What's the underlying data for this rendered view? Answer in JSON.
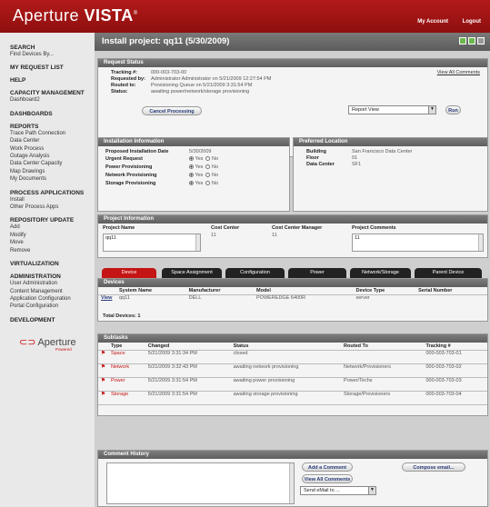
{
  "app": {
    "brand_light": "Aperture ",
    "brand_bold": "VISTA",
    "brand_reg": "®"
  },
  "toplinks": {
    "account": "My Account",
    "logout": "Logout"
  },
  "sidebar": {
    "sections": [
      {
        "head": "SEARCH",
        "items": [
          "Find Devices By..."
        ]
      },
      {
        "head": "MY REQUEST LIST",
        "items": []
      },
      {
        "head": "HELP",
        "items": []
      },
      {
        "head": "CAPACITY MANAGEMENT",
        "items": [
          "Dashboard2"
        ]
      },
      {
        "head": "DASHBOARDS",
        "items": []
      },
      {
        "head": "REPORTS",
        "items": [
          "Trace Path Connection",
          "Data Center",
          "Work Process",
          "Outage Analysis",
          "Data Center Capacity",
          "Map Drawings",
          "My Documents"
        ]
      },
      {
        "head": "PROCESS APPLICATIONS",
        "items": [
          "Install",
          "Other Process Apps"
        ]
      },
      {
        "head": "REPOSITORY UPDATE",
        "items": [
          "Add",
          "Modify",
          "Move",
          "Remove"
        ]
      },
      {
        "head": "VIRTUALIZATION",
        "items": []
      },
      {
        "head": "ADMINISTRATION",
        "items": [
          "User Administration",
          "Content Management",
          "Application Configuration",
          "Portal Configuration"
        ]
      },
      {
        "head": "DEVELOPMENT",
        "items": []
      }
    ],
    "logo": "Aperture",
    "logo_sub": "Powered"
  },
  "page": {
    "title": "Install project: qq11 (5/30/2009)"
  },
  "request_status": {
    "header": "Request Status",
    "tracking_label": "Tracking #:",
    "tracking_value": "000-003-703-00",
    "requested_label": "Requested by:",
    "requested_value": "Administrator Administrator on 5/21/2009 12:27:54 PM",
    "routed_label": "Routed to:",
    "routed_value": "Provisioning Queue on 5/21/2009 3:31:54 PM",
    "status_label": "Status:",
    "status_value": "awaiting power/network/storage provisioning",
    "view_all_comments": "View All Comments",
    "cancel_button": "Cancel Processing",
    "report_view": "Report View",
    "run_button": "Run"
  },
  "installation_info": {
    "header": "Installation Information",
    "date_label": "Proposed Installation Date",
    "date_value": "5/30/2009",
    "rows": [
      {
        "label": "Urgent Request",
        "yes": "Yes",
        "no": "No"
      },
      {
        "label": "Power Provisioning",
        "yes": "Yes",
        "no": "No"
      },
      {
        "label": "Network Provisioning",
        "yes": "Yes",
        "no": "No"
      },
      {
        "label": "Storage Provisioning",
        "yes": "Yes",
        "no": "No"
      }
    ]
  },
  "preferred_location": {
    "header": "Preferred Location",
    "building_label": "Building",
    "building_value": "San Francisco Data Center",
    "floor_label": "Floor",
    "floor_value": "01",
    "dc_label": "Data Center",
    "dc_value": "SF1"
  },
  "project_info": {
    "header": "Project Information",
    "name_label": "Project Name",
    "name_value": "qq11",
    "cc_label": "Cost Center",
    "cc_value": "11",
    "ccm_label": "Cost Center Manager",
    "ccm_value": "11",
    "comments_label": "Project Comments",
    "comments_value": "11"
  },
  "tabs": [
    "Device",
    "Space Assignment",
    "Configuration",
    "Power",
    "Network/Storage",
    "Parent Device"
  ],
  "devices": {
    "header": "Devices",
    "columns": [
      "System Name",
      "Manufacturer",
      "Model",
      "Device Type",
      "Serial Number"
    ],
    "rows": [
      {
        "view": "View",
        "system": "qq11",
        "manufacturer": "DELL",
        "model": "POWEREDGE 6400R",
        "type": "server",
        "serial": ""
      }
    ],
    "total": "Total Devices: 1"
  },
  "subtasks": {
    "header": "Subtasks",
    "columns": [
      "Type",
      "Changed",
      "Status",
      "Routed To",
      "Tracking #"
    ],
    "rows": [
      {
        "type": "Space",
        "changed": "5/21/2009 3:31:34 PM",
        "status": "closed",
        "routed": "",
        "tracking": "000-003-703-01"
      },
      {
        "type": "Network",
        "changed": "5/21/2009 3:32:43 PM",
        "status": "awaiting network provisioning",
        "routed": "Network/Provisioners",
        "tracking": "000-003-703-02"
      },
      {
        "type": "Power",
        "changed": "5/21/2009 3:31:54 PM",
        "status": "awaiting power provisioning",
        "routed": "Power/Techs",
        "tracking": "000-003-703-03"
      },
      {
        "type": "Storage",
        "changed": "5/21/2009 3:31:54 PM",
        "status": "awaiting storage provisioning",
        "routed": "Storage/Provisioners",
        "tracking": "000-003-703-04"
      }
    ]
  },
  "comment_history": {
    "header": "Comment History",
    "add_button": "Add a Comment",
    "view_all_button": "View All Comments",
    "compose_button": "Compose email...",
    "send_select": "Send eMail to ..."
  }
}
